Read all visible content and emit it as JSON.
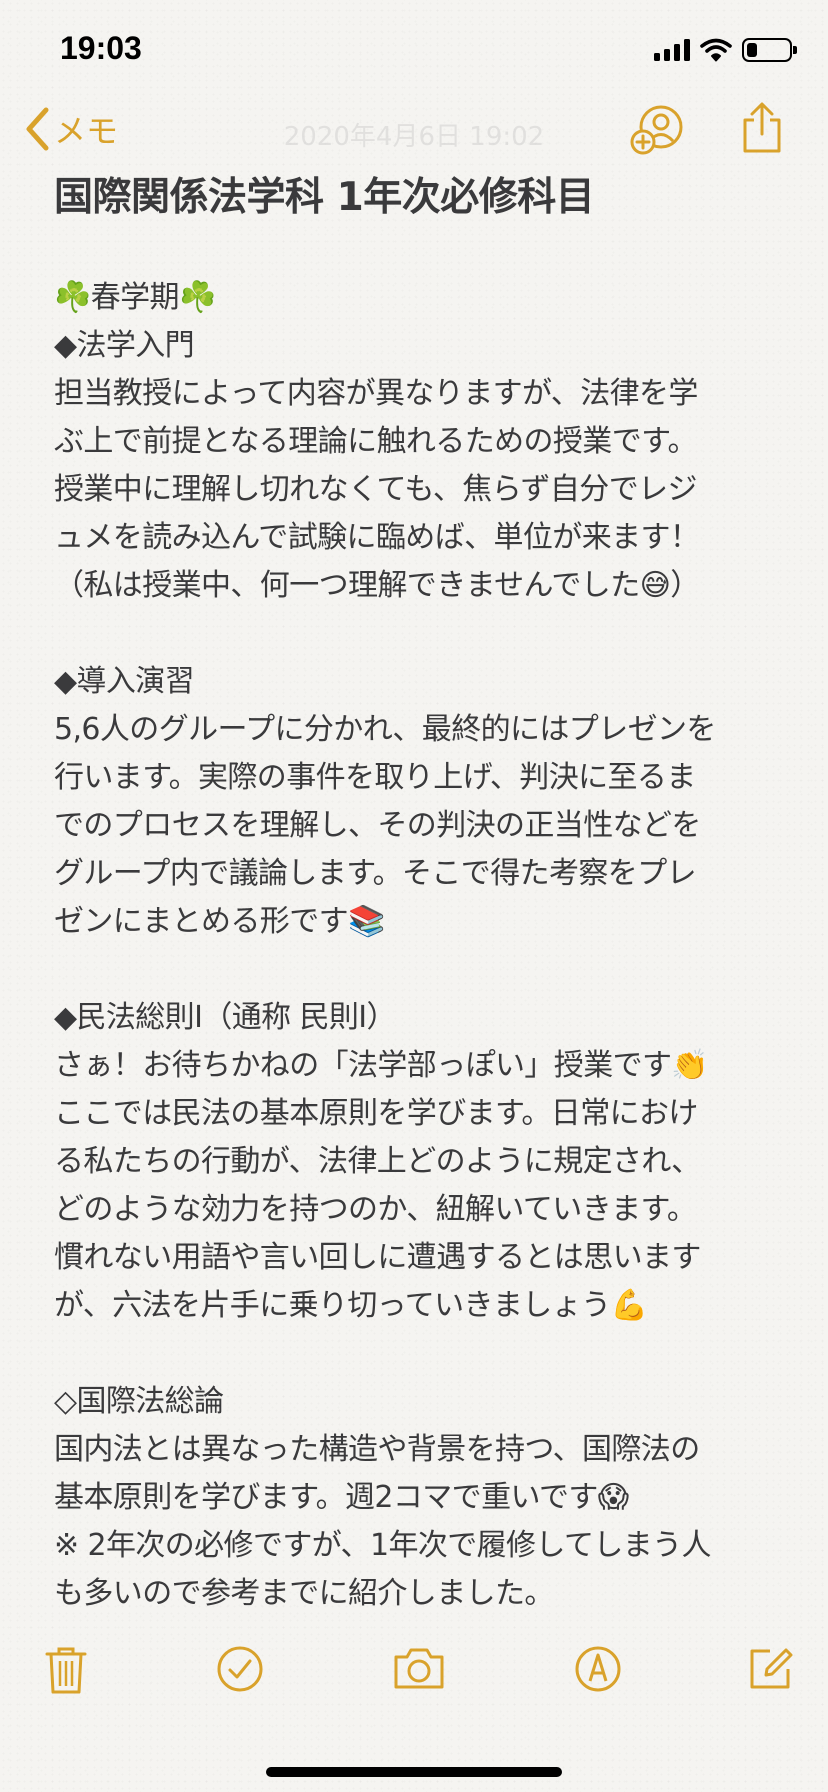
{
  "status_bar": {
    "time": "19:03",
    "icons": [
      "cellular-signal-icon",
      "wifi-icon",
      "battery-icon"
    ],
    "battery_level": 0.25
  },
  "nav": {
    "back_label": "メモ",
    "date": "2020年4月6日 19:02",
    "accent_color": "#d9a22b"
  },
  "note": {
    "title": "国際関係法学科 1年次必修科目",
    "sections": [
      {
        "lines": [
          "☘️春学期☘️",
          "◆法学入門",
          "担当教授によって内容が異なりますが、法律を学",
          "ぶ上で前提となる理論に触れるための授業です。",
          "授業中に理解し切れなくても、焦らず自分でレジ",
          "ュメを読み込んで試験に臨めば、単位が来ます！",
          "（私は授業中、何一つ理解できませんでした😅）"
        ]
      },
      {
        "lines": [
          "◆導入演習",
          "5,6人のグループに分かれ、最終的にはプレゼンを",
          "行います。実際の事件を取り上げ、判決に至るま",
          "でのプロセスを理解し、その判決の正当性などを",
          "グループ内で議論します。そこで得た考察をプレ",
          "ゼンにまとめる形です📚"
        ]
      },
      {
        "lines": [
          "◆民法総則Ⅰ（通称 民則Ⅰ）",
          "さぁ！お待ちかねの「法学部っぽい」授業です👏",
          "ここでは民法の基本原則を学びます。日常におけ",
          "る私たちの行動が、法律上どのように規定され、",
          "どのような効力を持つのか、紐解いていきます。",
          "慣れない用語や言い回しに遭遇するとは思います",
          "が、六法を片手に乗り切っていきましょう💪"
        ]
      },
      {
        "lines": [
          "◇国際法総論",
          "国内法とは異なった構造や背景を持つ、国際法の",
          "基本原則を学びます。週2コマで重いです😱",
          "※ 2年次の必修ですが、1年次で履修してしまう人",
          "も多いので参考までに紹介しました。"
        ]
      }
    ]
  },
  "toolbar": {
    "items": [
      "trash-icon",
      "checklist-icon",
      "camera-icon",
      "markup-pen-icon",
      "compose-icon"
    ]
  }
}
